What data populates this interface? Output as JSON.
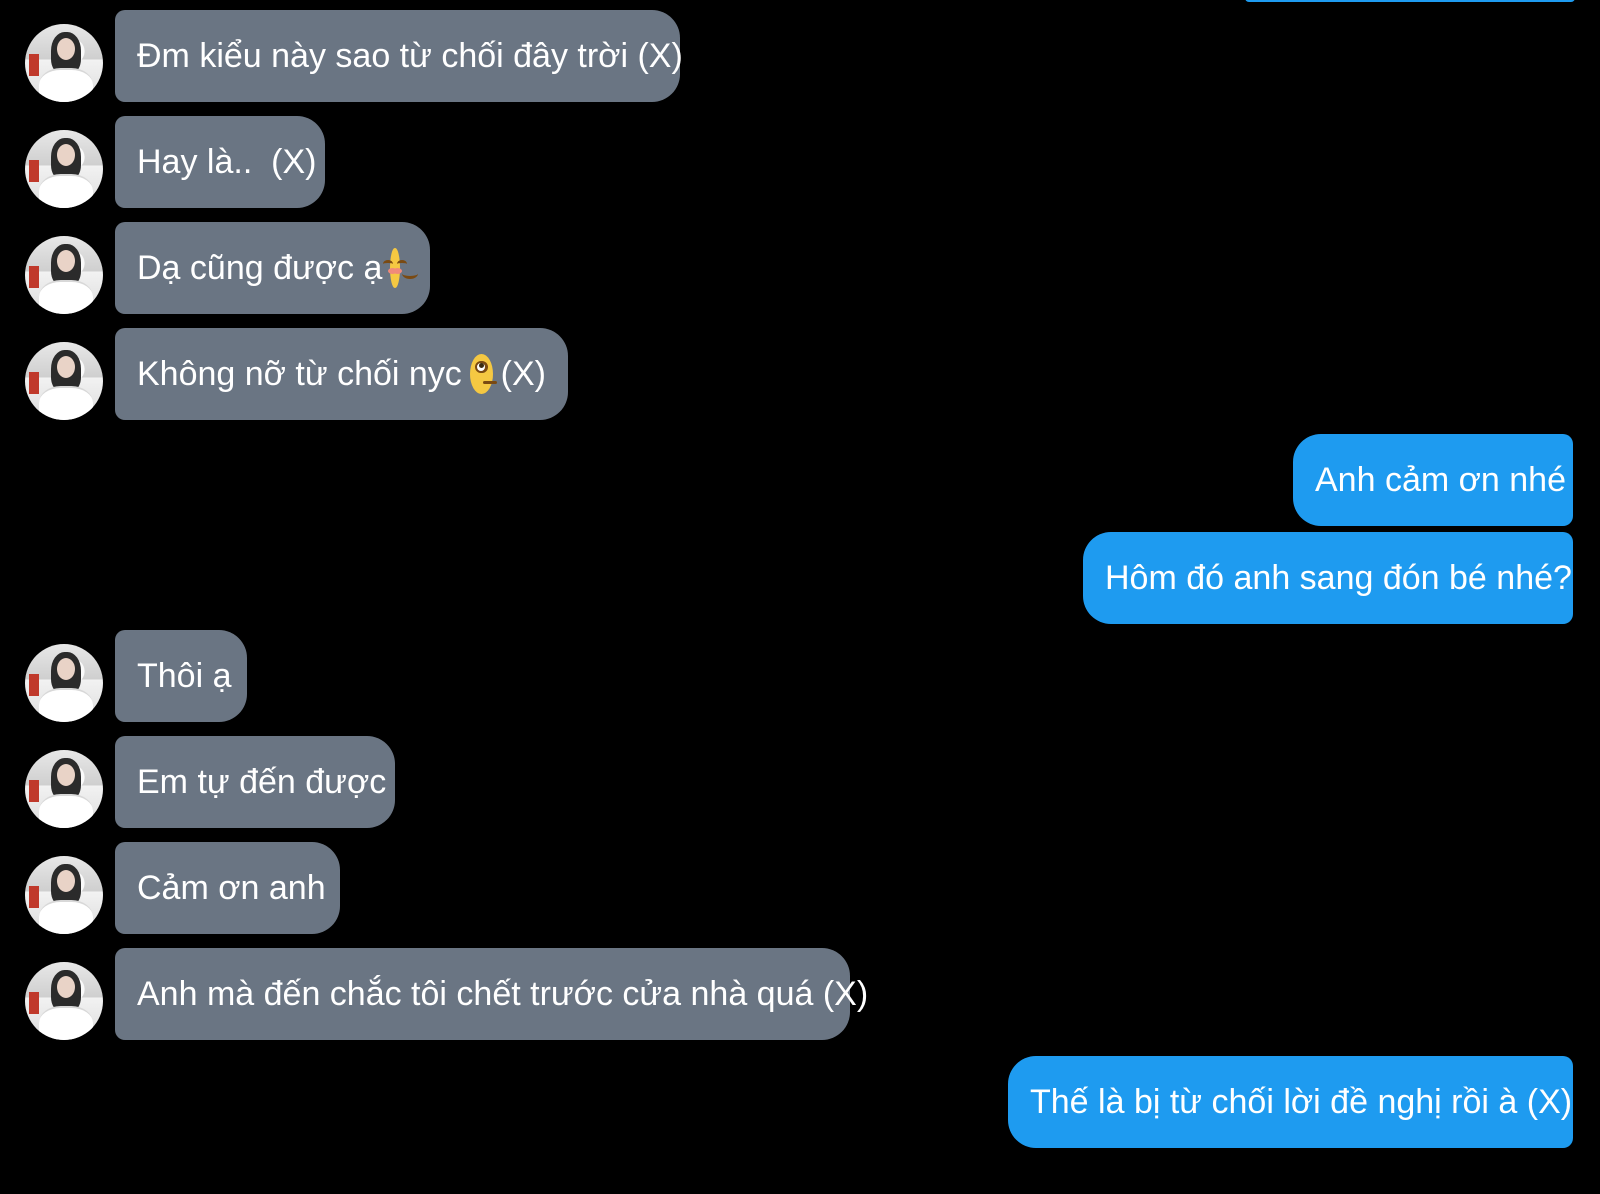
{
  "colors": {
    "background": "#000000",
    "incoming_bubble": "#6a7583",
    "outgoing_bubble": "#1e9bf0",
    "text": "#ffffff"
  },
  "messages": [
    {
      "sender": "contact",
      "text": "Đm kiểu này sao từ chối đây trời (X)"
    },
    {
      "sender": "contact",
      "text": "Hay là..  (X)"
    },
    {
      "sender": "contact",
      "text_before": "Dạ cũng được ạ",
      "emoji": "smiling-face-icon",
      "text_after": ""
    },
    {
      "sender": "contact",
      "text_before": "Không nỡ từ chối nyc",
      "emoji": "eye-roll-face-icon",
      "text_after": "(X)"
    },
    {
      "sender": "me",
      "text": "Anh cảm ơn nhé"
    },
    {
      "sender": "me",
      "text": "Hôm đó anh sang đón bé nhé?"
    },
    {
      "sender": "contact",
      "text": "Thôi ạ"
    },
    {
      "sender": "contact",
      "text": "Em tự đến được"
    },
    {
      "sender": "contact",
      "text": "Cảm ơn anh"
    },
    {
      "sender": "contact",
      "text": "Anh mà đến chắc tôi chết trước cửa nhà quá (X)"
    },
    {
      "sender": "me",
      "text": "Thế là bị từ chối lời đề nghị rồi à (X)"
    }
  ]
}
